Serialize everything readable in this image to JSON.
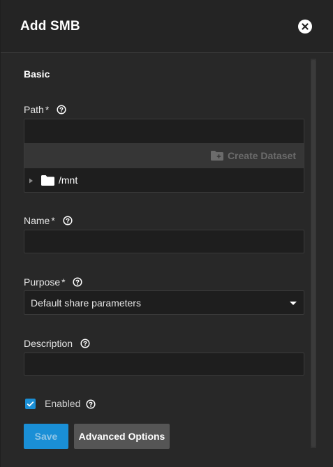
{
  "header": {
    "title": "Add SMB"
  },
  "section": {
    "title": "Basic"
  },
  "path": {
    "label": "Path",
    "required_mark": "*",
    "value": "",
    "create_dataset_label": "Create Dataset",
    "tree": [
      {
        "label": "/mnt",
        "expanded": false
      }
    ]
  },
  "name": {
    "label": "Name",
    "required_mark": "*",
    "value": ""
  },
  "purpose": {
    "label": "Purpose",
    "required_mark": "*",
    "selected": "Default share parameters"
  },
  "description": {
    "label": "Description",
    "value": ""
  },
  "enabled": {
    "label": "Enabled",
    "checked": true
  },
  "actions": {
    "save_label": "Save",
    "advanced_label": "Advanced Options"
  },
  "colors": {
    "accent": "#1a8fd6",
    "background": "#282828",
    "input_bg": "#1e1e1e"
  },
  "icons": [
    "close-icon",
    "help-icon",
    "folder-plus-icon",
    "folder-icon",
    "caret-right-icon",
    "dropdown-arrow-icon",
    "checkmark-icon"
  ]
}
